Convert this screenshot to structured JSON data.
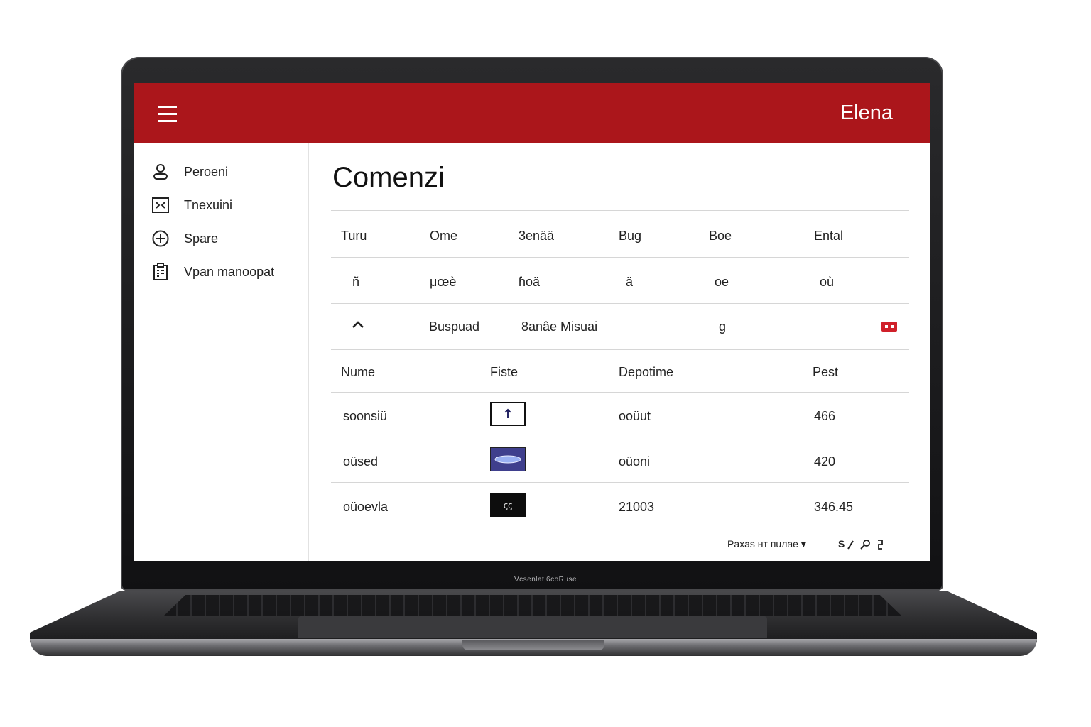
{
  "laptop": {
    "bezel_label": "Vcsenlatl6coRuse"
  },
  "appbar": {
    "menu_icon": "hamburger-icon",
    "user_name": "Elena",
    "color": "#ab161b"
  },
  "sidebar": {
    "items": [
      {
        "label": "Peroeni",
        "icon": "person-icon"
      },
      {
        "label": "Tnexuini",
        "icon": "box-arrows-icon"
      },
      {
        "label": "Spare",
        "icon": "plus-circle-icon"
      },
      {
        "label": "Vpan manoopat",
        "icon": "clipboard-icon"
      }
    ]
  },
  "main": {
    "title": "Comenzi",
    "orders_table": {
      "headers": [
        "Turu",
        "Ome",
        "3enää",
        "Bug",
        "Boe",
        "Ental"
      ],
      "row": [
        "ñ",
        "μœè",
        "ɦoä",
        "ä",
        "oe",
        "où"
      ]
    },
    "expanded_order": {
      "toggle_icon": "chevron-up-icon",
      "customer": "Buspuad",
      "detail": "8anâe Misuai",
      "code": "g",
      "status_icon": "red-badge-icon"
    },
    "items_table": {
      "headers": [
        "Nume",
        "Fiste",
        "Depotime",
        "Pest"
      ],
      "rows": [
        {
          "name": "soonsiü",
          "thumb": "upload-arrow-icon",
          "depot": "ooüut",
          "price": "466"
        },
        {
          "name": "oüsed",
          "thumb": "blue-lens-image",
          "depot": "oüoni",
          "price": "420"
        },
        {
          "name": "oüoevla",
          "thumb_text": "ꞔꞔ",
          "depot": "21003",
          "price": "346.45"
        }
      ]
    },
    "footer": {
      "rows_per_page": "Paxas нт пuлae ▾",
      "actions_label": "S",
      "action_icons": [
        "edit-icon",
        "search-icon",
        "export-icon"
      ]
    }
  }
}
